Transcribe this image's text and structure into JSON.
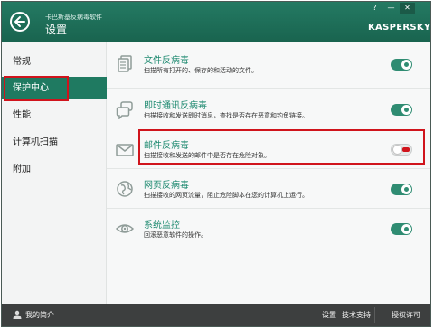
{
  "header": {
    "app_name": "卡巴斯基反病毒软件",
    "title": "设置",
    "help": "?",
    "minimize": "—",
    "close": "✕",
    "brand": "KASPERSKY"
  },
  "sidebar": {
    "items": [
      {
        "label": "常规"
      },
      {
        "label": "保护中心"
      },
      {
        "label": "性能"
      },
      {
        "label": "计算机扫描"
      },
      {
        "label": "附加"
      }
    ],
    "active_index": 1
  },
  "components": [
    {
      "title": "文件反病毒",
      "desc": "扫描所有打开的、保存的和活动的文件。",
      "enabled": true,
      "icon": "file-antivirus-icon"
    },
    {
      "title": "即时通讯反病毒",
      "desc": "扫描接收和发送即时消息，查找是否存在恶意和钓鱼链接。",
      "enabled": true,
      "icon": "im-antivirus-icon"
    },
    {
      "title": "邮件反病毒",
      "desc": "扫描接收和发送的邮件中是否存在危险对象。",
      "enabled": false,
      "icon": "mail-antivirus-icon"
    },
    {
      "title": "网页反病毒",
      "desc": "扫描接收的网页流量，阻止危险脚本在您的计算机上运行。",
      "enabled": true,
      "icon": "web-antivirus-icon"
    },
    {
      "title": "系统监控",
      "desc": "回滚恶意软件的操作。",
      "enabled": true,
      "icon": "system-watcher-icon"
    }
  ],
  "footer": {
    "profile": "我的简介",
    "settings": "设置",
    "support": "技术支持",
    "license": "授权许可"
  },
  "colors": {
    "header": "#1f7a61",
    "accent": "#1e8a70",
    "highlight": "#d0141c",
    "footer": "#3d3f3f"
  }
}
